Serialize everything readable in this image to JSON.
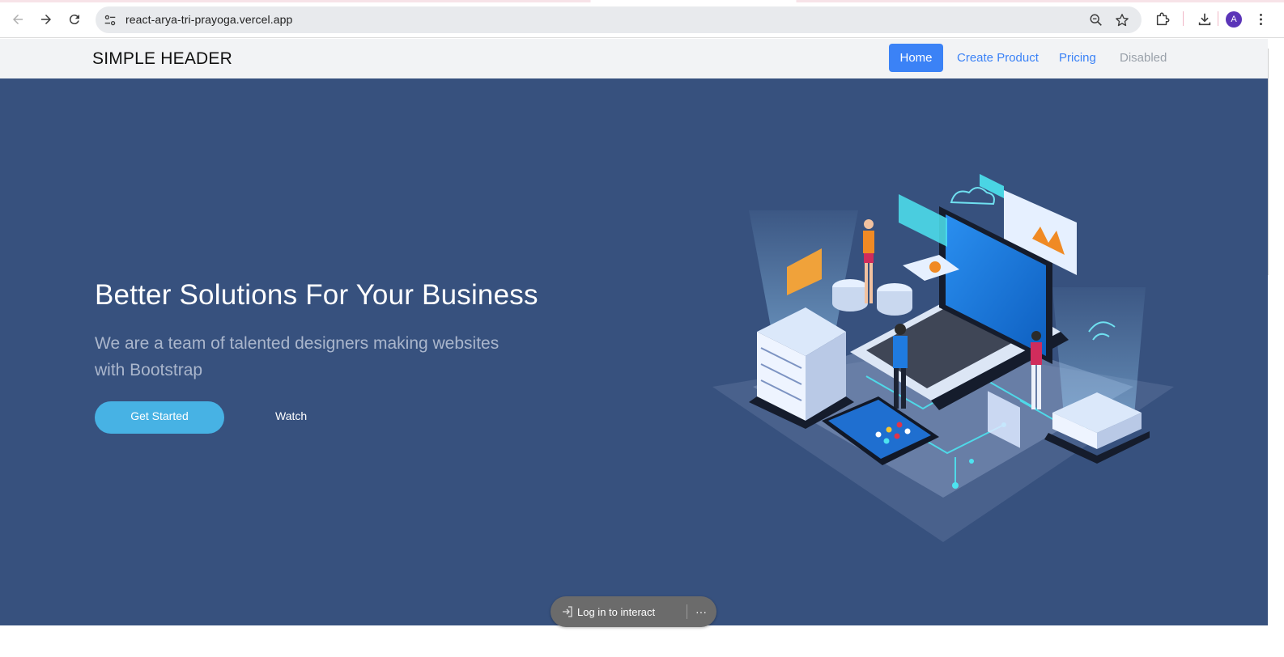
{
  "browser": {
    "url": "react-arya-tri-prayoga.vercel.app",
    "avatar_letter": "A",
    "icons": {
      "back": "arrow-left-icon",
      "forward": "arrow-right-icon",
      "reload": "reload-icon",
      "site_settings": "tune-icon",
      "zoom": "zoom-out-icon",
      "bookmark": "star-icon",
      "extensions": "puzzle-icon",
      "downloads": "download-icon",
      "menu": "more-vertical-icon"
    }
  },
  "header": {
    "brand": "SIMPLE HEADER",
    "nav": [
      {
        "label": "Home",
        "active": true
      },
      {
        "label": "Create Product",
        "active": false
      },
      {
        "label": "Pricing",
        "active": false
      },
      {
        "label": "Disabled",
        "active": false,
        "disabled": true
      }
    ]
  },
  "hero": {
    "title": "Better Solutions For Your Business",
    "subtitle": "We are a team of talented designers making websites with Bootstrap",
    "primary_button": "Get Started",
    "secondary_button": "Watch",
    "illustration": "isometric-tech-illustration"
  },
  "overlay": {
    "login_label": "Log in to interact",
    "more_label": "···"
  },
  "colors": {
    "hero_bg": "#37517e",
    "accent": "#47b2e4",
    "nav_active": "#3b82f6",
    "header_bg": "#f2f3f5"
  }
}
